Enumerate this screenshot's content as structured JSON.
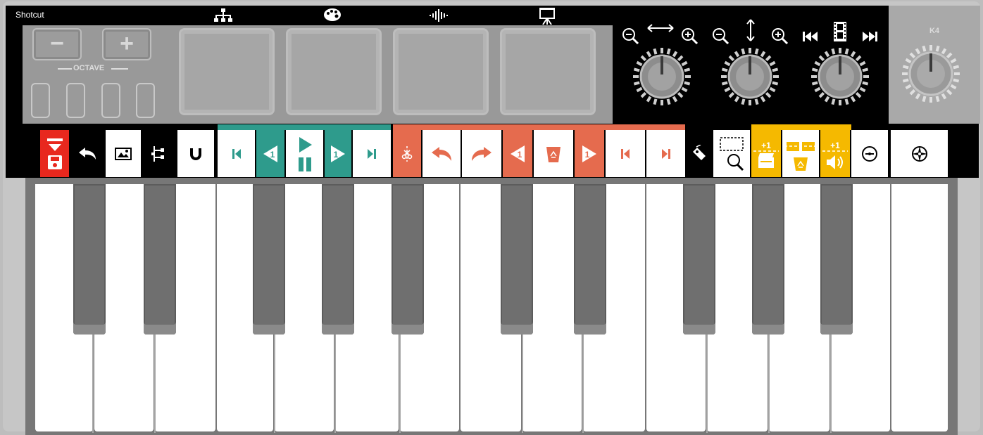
{
  "app": {
    "title": "Shotcut"
  },
  "top_icons": [
    "hierarchy-icon",
    "palette-icon",
    "waveform-icon",
    "projector-icon"
  ],
  "controller": {
    "octave_label": "OCTAVE",
    "octave_minus": "−",
    "octave_plus": "+",
    "knob4_label": "K4"
  },
  "knob_groups": [
    {
      "name": "horizontal-zoom",
      "icons": [
        "zoom-out-icon",
        "horizontal-arrows-icon",
        "zoom-in-icon"
      ]
    },
    {
      "name": "vertical-zoom",
      "icons": [
        "zoom-out-icon",
        "vertical-arrows-icon",
        "zoom-in-icon"
      ]
    },
    {
      "name": "navigation",
      "icons": [
        "skip-back-icon",
        "film-strip-icon",
        "skip-forward-icon"
      ]
    }
  ],
  "toolbar": {
    "buttons": [
      {
        "name": "save-button",
        "icon": "save-icon"
      },
      {
        "name": "undo-button",
        "icon": "undo-icon"
      },
      {
        "name": "image-button",
        "icon": "image-icon"
      },
      {
        "name": "tree-button",
        "icon": "tree-icon"
      },
      {
        "name": "snap-button",
        "icon": "magnet-icon"
      },
      {
        "name": "go-start-button",
        "icon": "go-start-icon"
      },
      {
        "name": "prev-frame-button",
        "icon": "prev-frame-icon"
      },
      {
        "name": "play-pause-button",
        "icon": "play-pause-icon"
      },
      {
        "name": "next-frame-button",
        "icon": "next-frame-icon"
      },
      {
        "name": "go-end-button",
        "icon": "go-end-icon"
      },
      {
        "name": "split-button",
        "icon": "scissors-icon"
      },
      {
        "name": "undo-edit-button",
        "icon": "undo-icon"
      },
      {
        "name": "redo-edit-button",
        "icon": "redo-icon"
      },
      {
        "name": "nudge-left-button",
        "icon": "prev-frame-icon"
      },
      {
        "name": "recycle-button",
        "icon": "recycle-bin-icon"
      },
      {
        "name": "nudge-right-button",
        "icon": "next-frame-icon"
      },
      {
        "name": "mark-in-button",
        "icon": "go-start-icon"
      },
      {
        "name": "mark-out-button",
        "icon": "go-end-icon"
      },
      {
        "name": "tag-button",
        "icon": "tag-icon"
      },
      {
        "name": "zoom-selection-button",
        "icon": "zoom-selection-icon"
      },
      {
        "name": "add-video-track-button",
        "icon": "clapper-icon",
        "badge": "+1"
      },
      {
        "name": "remove-track-button",
        "icon": "recycle-bin-icon"
      },
      {
        "name": "add-audio-track-button",
        "icon": "speaker-icon",
        "badge": "+1"
      },
      {
        "name": "center-playhead-button",
        "icon": "target-icon"
      },
      {
        "name": "compass-button",
        "icon": "compass-icon"
      }
    ]
  },
  "colors": {
    "teal": "#2e9b8c",
    "orange": "#e56b4e",
    "yellow": "#f5b900",
    "red": "#e8281e",
    "black": "#000000",
    "white": "#ffffff"
  }
}
